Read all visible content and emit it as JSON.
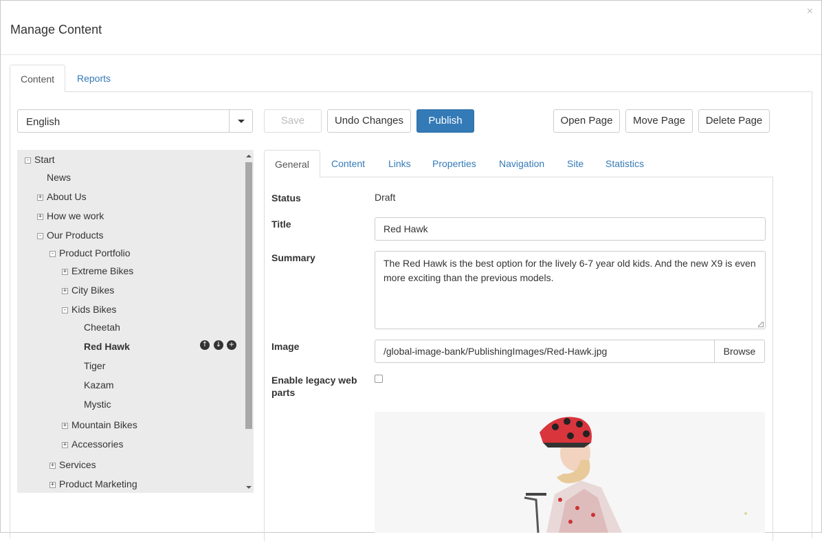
{
  "window": {
    "title": "Manage Content",
    "close_glyph": "×"
  },
  "top_tabs": [
    {
      "label": "Content",
      "active": true
    },
    {
      "label": "Reports",
      "active": false
    }
  ],
  "language": {
    "selected": "English"
  },
  "toolbar": {
    "save": "Save",
    "undo": "Undo Changes",
    "publish": "Publish",
    "open_page": "Open Page",
    "move_page": "Move Page",
    "delete_page": "Delete Page"
  },
  "tree": {
    "nodes": [
      {
        "label": "Start",
        "toggle": "-"
      },
      {
        "label": "News",
        "toggle": ""
      },
      {
        "label": "About Us",
        "toggle": "+"
      },
      {
        "label": "How we work",
        "toggle": "+"
      },
      {
        "label": "Our Products",
        "toggle": "-"
      },
      {
        "label": "Product Portfolio",
        "toggle": "-"
      },
      {
        "label": "Extreme Bikes",
        "toggle": "+"
      },
      {
        "label": "City Bikes",
        "toggle": "+"
      },
      {
        "label": "Kids Bikes",
        "toggle": "-"
      },
      {
        "label": "Cheetah",
        "toggle": ""
      },
      {
        "label": "Red Hawk",
        "toggle": "",
        "selected": true
      },
      {
        "label": "Tiger",
        "toggle": ""
      },
      {
        "label": "Kazam",
        "toggle": ""
      },
      {
        "label": "Mystic",
        "toggle": ""
      },
      {
        "label": "Mountain Bikes",
        "toggle": "+"
      },
      {
        "label": "Accessories",
        "toggle": "+"
      },
      {
        "label": "Services",
        "toggle": "+"
      },
      {
        "label": "Product Marketing",
        "toggle": "+"
      }
    ],
    "actions": [
      "arrow-up-circle-icon",
      "arrow-down-circle-icon",
      "plus-circle-icon"
    ]
  },
  "sub_tabs": [
    {
      "label": "General",
      "active": true
    },
    {
      "label": "Content",
      "active": false
    },
    {
      "label": "Links",
      "active": false
    },
    {
      "label": "Properties",
      "active": false
    },
    {
      "label": "Navigation",
      "active": false
    },
    {
      "label": "Site",
      "active": false
    },
    {
      "label": "Statistics",
      "active": false
    }
  ],
  "form": {
    "status_label": "Status",
    "status_value": "Draft",
    "title_label": "Title",
    "title_value": "Red Hawk",
    "summary_label": "Summary",
    "summary_value": "The Red Hawk is the best option for the lively 6-7 year old kids. And the new X9 is even more exciting than the previous models.",
    "image_label": "Image",
    "image_value": "/global-image-bank/PublishingImages/Red-Hawk.jpg",
    "browse_label": "Browse",
    "legacy_label": "Enable legacy web parts",
    "legacy_checked": false
  },
  "colors": {
    "primary": "#337ab7",
    "link": "#337ab7",
    "tree_bg": "#ebebeb"
  }
}
